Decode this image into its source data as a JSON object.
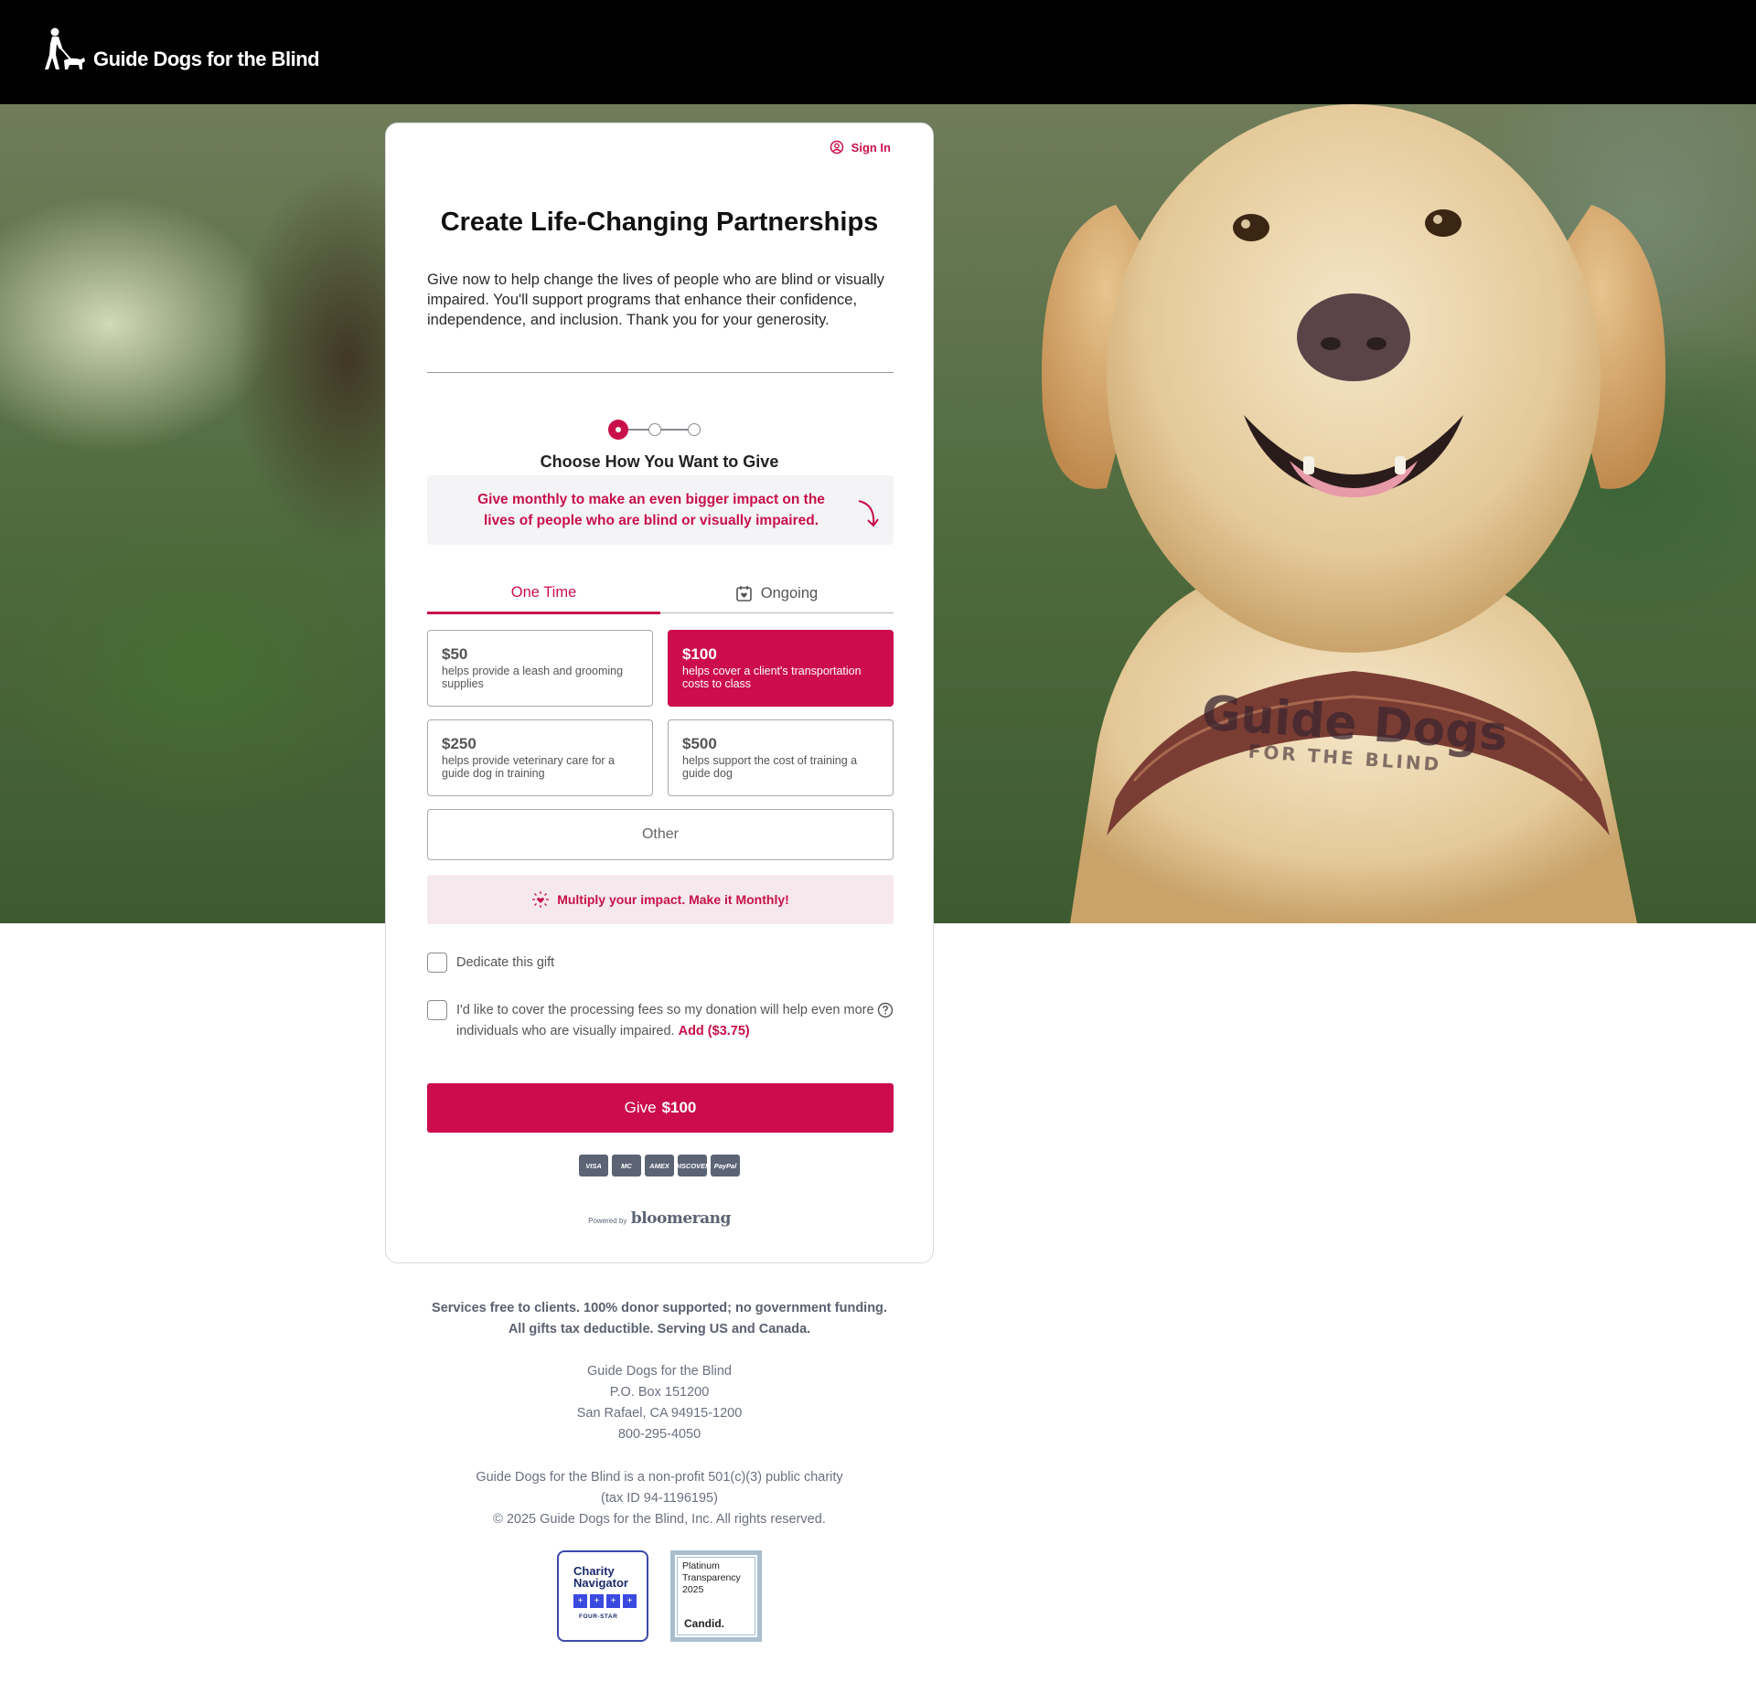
{
  "header": {
    "logo_text": "Guide Dogs for the Blind",
    "logo_icon": "person-with-guide-dog-icon"
  },
  "hero": {
    "harness_text": "Guide Dogs",
    "harness_subtext": "FOR THE BLIND"
  },
  "form": {
    "sign_in_label": "Sign In",
    "title": "Create Life-Changing Partnerships",
    "intro": "Give now to help change the lives of people who are blind or visually impaired. You'll support programs that enhance their confidence, independence, and inclusion. Thank you for your generosity.",
    "current_step": 1,
    "total_steps": 3,
    "step_title": "Choose How You Want to Give",
    "promo_text": "Give monthly to make an even bigger impact on the lives of people who are blind or visually impaired.",
    "tabs": [
      {
        "label": "One Time",
        "selected": true
      },
      {
        "label": "Ongoing",
        "selected": false,
        "icon": "calendar-heart-icon"
      }
    ],
    "amounts": [
      {
        "value": "$50",
        "description": "helps provide a leash and grooming supplies",
        "selected": false
      },
      {
        "value": "$100",
        "description": "helps cover a client's transportation costs to class",
        "selected": true
      },
      {
        "value": "$250",
        "description": "helps provide veterinary care for a guide dog in training",
        "selected": false
      },
      {
        "value": "$500",
        "description": "helps support the cost of training a guide dog",
        "selected": false
      }
    ],
    "other_label": "Other",
    "multiply_text": "Multiply your impact. Make it Monthly!",
    "dedicate_label": "Dedicate this gift",
    "dedicate_checked": false,
    "fee_text": "I'd like to cover the processing fees so my donation will help even more individuals who are visually impaired.",
    "fee_add_label": "Add ($3.75)",
    "fee_checked": false,
    "give_button_prefix": "Give",
    "give_button_amount": "$100",
    "payment_methods": [
      "VISA",
      "MC",
      "AMEX",
      "DISCOVER",
      "PayPal"
    ],
    "powered_by_prefix": "Powered by",
    "powered_by_brand": "bloomerang"
  },
  "footer": {
    "tagline_line1": "Services free to clients. 100% donor supported; no government funding.",
    "tagline_line2": "All gifts tax deductible. Serving US and Canada.",
    "address": [
      "Guide Dogs for the Blind",
      "P.O. Box 151200",
      "San Rafael, CA 94915-1200",
      "800-295-4050"
    ],
    "legal": [
      "Guide Dogs for the Blind is a non-profit 501(c)(3) public charity",
      "(tax ID 94-1196195)",
      "© 2025 Guide Dogs for the Blind, Inc. All rights reserved."
    ],
    "badge_charity_navigator": {
      "line1": "Charity",
      "line2": "Navigator",
      "rating": "FOUR-STAR"
    },
    "badge_candid": {
      "line1": "Platinum",
      "line2": "Transparency",
      "line3": "2025",
      "brand": "Candid."
    }
  },
  "colors": {
    "accent": "#cc0c4c",
    "header_bg": "#000000",
    "muted_text": "#6b7080"
  }
}
